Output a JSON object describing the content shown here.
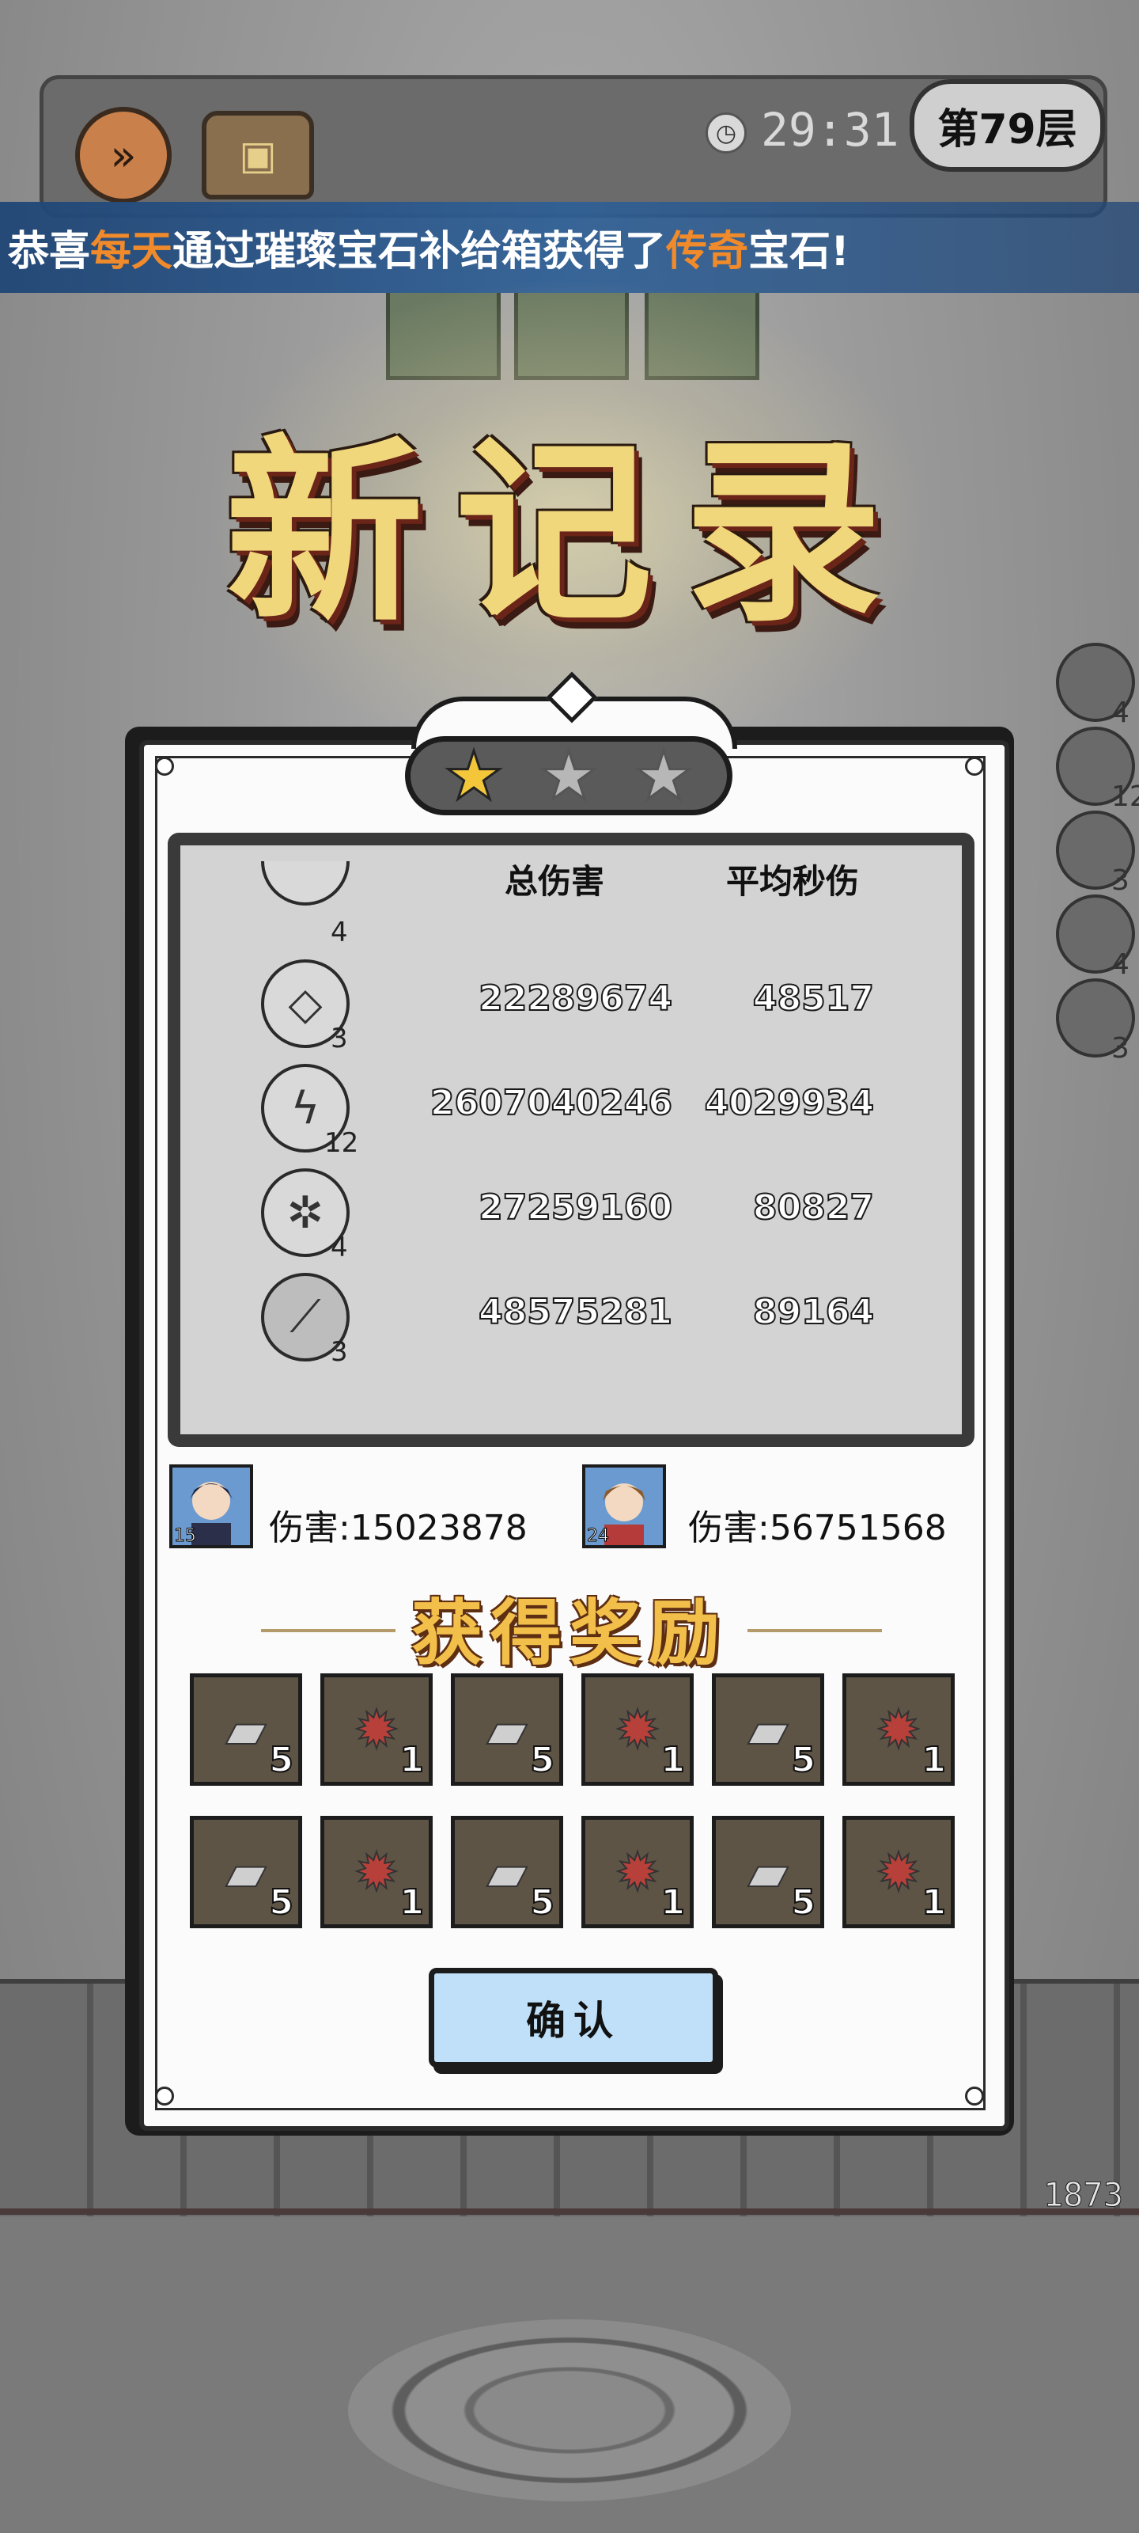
{
  "hud": {
    "timer": "29:31",
    "floor_label": "第79层",
    "speed_icon": "fast-forward-icon",
    "chest_icon": "treasure-chest-icon"
  },
  "banner": {
    "prefix": "恭喜",
    "player": "每天",
    "middle": "通过璀璨宝石补给箱获得了",
    "rarity": "传奇",
    "suffix": "宝石!"
  },
  "title": "新记录",
  "stars": {
    "earned": 1,
    "total": 3
  },
  "stats": {
    "header_total": "总伤害",
    "header_avg": "平均秒伤",
    "rows": [
      {
        "icon": "crystal-cube-skill-icon",
        "level": "3",
        "total": "22289674",
        "avg": "48517"
      },
      {
        "icon": "lightning-skill-icon",
        "level": "12",
        "total": "2607040246",
        "avg": "4029934"
      },
      {
        "icon": "ice-shard-skill-icon",
        "level": "4",
        "total": "27259160",
        "avg": "80827"
      },
      {
        "icon": "dark-slash-skill-icon",
        "level": "3",
        "total": "48575281",
        "avg": "89164"
      }
    ],
    "partial_row_level": "4"
  },
  "heroes": [
    {
      "level": "15",
      "damage": "伤害:15023878"
    },
    {
      "level": "24",
      "damage": "伤害:56751568"
    }
  ],
  "side_skills": [
    "4",
    "12",
    "3",
    "4",
    "3"
  ],
  "rewards_title": "获得奖励",
  "rewards": [
    {
      "type": "gear",
      "count": "5"
    },
    {
      "type": "sun",
      "count": "1"
    },
    {
      "type": "gear",
      "count": "5"
    },
    {
      "type": "sun",
      "count": "1"
    },
    {
      "type": "gear",
      "count": "5"
    },
    {
      "type": "sun",
      "count": "1"
    },
    {
      "type": "gear",
      "count": "5"
    },
    {
      "type": "sun",
      "count": "1"
    },
    {
      "type": "gear",
      "count": "5"
    },
    {
      "type": "sun",
      "count": "1"
    },
    {
      "type": "gear",
      "count": "5"
    },
    {
      "type": "sun",
      "count": "1"
    }
  ],
  "confirm_label": "确认",
  "gold_counter": "1873",
  "colors": {
    "banner_highlight": "#f08a2a",
    "title_gold": "#f1d77c",
    "confirm_bg": "#bfe0f8"
  }
}
